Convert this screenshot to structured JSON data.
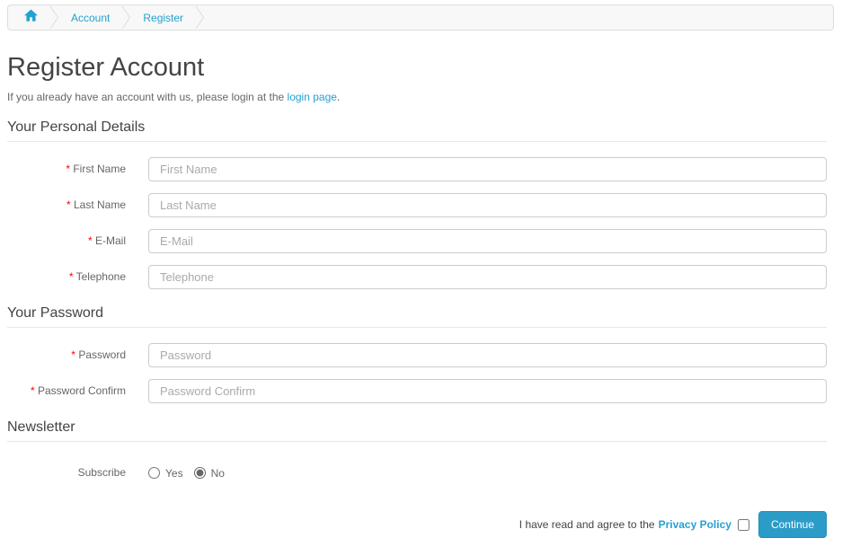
{
  "breadcrumb": {
    "home_icon": "home-icon",
    "items": [
      {
        "label": "Account"
      },
      {
        "label": "Register"
      }
    ]
  },
  "page": {
    "title": "Register Account",
    "intro_text": "If you already have an account with us, please login at the",
    "login_link_text": "login page",
    "intro_suffix": "."
  },
  "required_marker": "*",
  "form": {
    "personal": {
      "legend": "Your Personal Details",
      "fields": [
        {
          "label": "First Name",
          "placeholder": "First Name",
          "value": "",
          "required": true
        },
        {
          "label": "Last Name",
          "placeholder": "Last Name",
          "value": "",
          "required": true
        },
        {
          "label": "E-Mail",
          "placeholder": "E-Mail",
          "value": "",
          "required": true
        },
        {
          "label": "Telephone",
          "placeholder": "Telephone",
          "value": "",
          "required": true
        }
      ]
    },
    "password": {
      "legend": "Your Password",
      "fields": [
        {
          "label": "Password",
          "placeholder": "Password",
          "value": "",
          "required": true
        },
        {
          "label": "Password Confirm",
          "placeholder": "Password Confirm",
          "value": "",
          "required": true
        }
      ]
    },
    "newsletter": {
      "legend": "Newsletter",
      "subscribe_label": "Subscribe",
      "options": [
        {
          "label": "Yes",
          "checked": false
        },
        {
          "label": "No",
          "checked": true
        }
      ]
    }
  },
  "footer": {
    "agree_text": "I have read and agree to the",
    "privacy_link_text": "Privacy Policy",
    "agree_checked": false,
    "continue_label": "Continue"
  },
  "colors": {
    "accent_link": "#23a1d1",
    "button_primary": "#2b9cc8",
    "button_primary_border": "#1f90bb",
    "required_red": "#ff0000",
    "heading_text": "#444444",
    "body_text": "#666666",
    "breadcrumb_bg": "#f8f8f8",
    "border_light": "#dddddd"
  }
}
